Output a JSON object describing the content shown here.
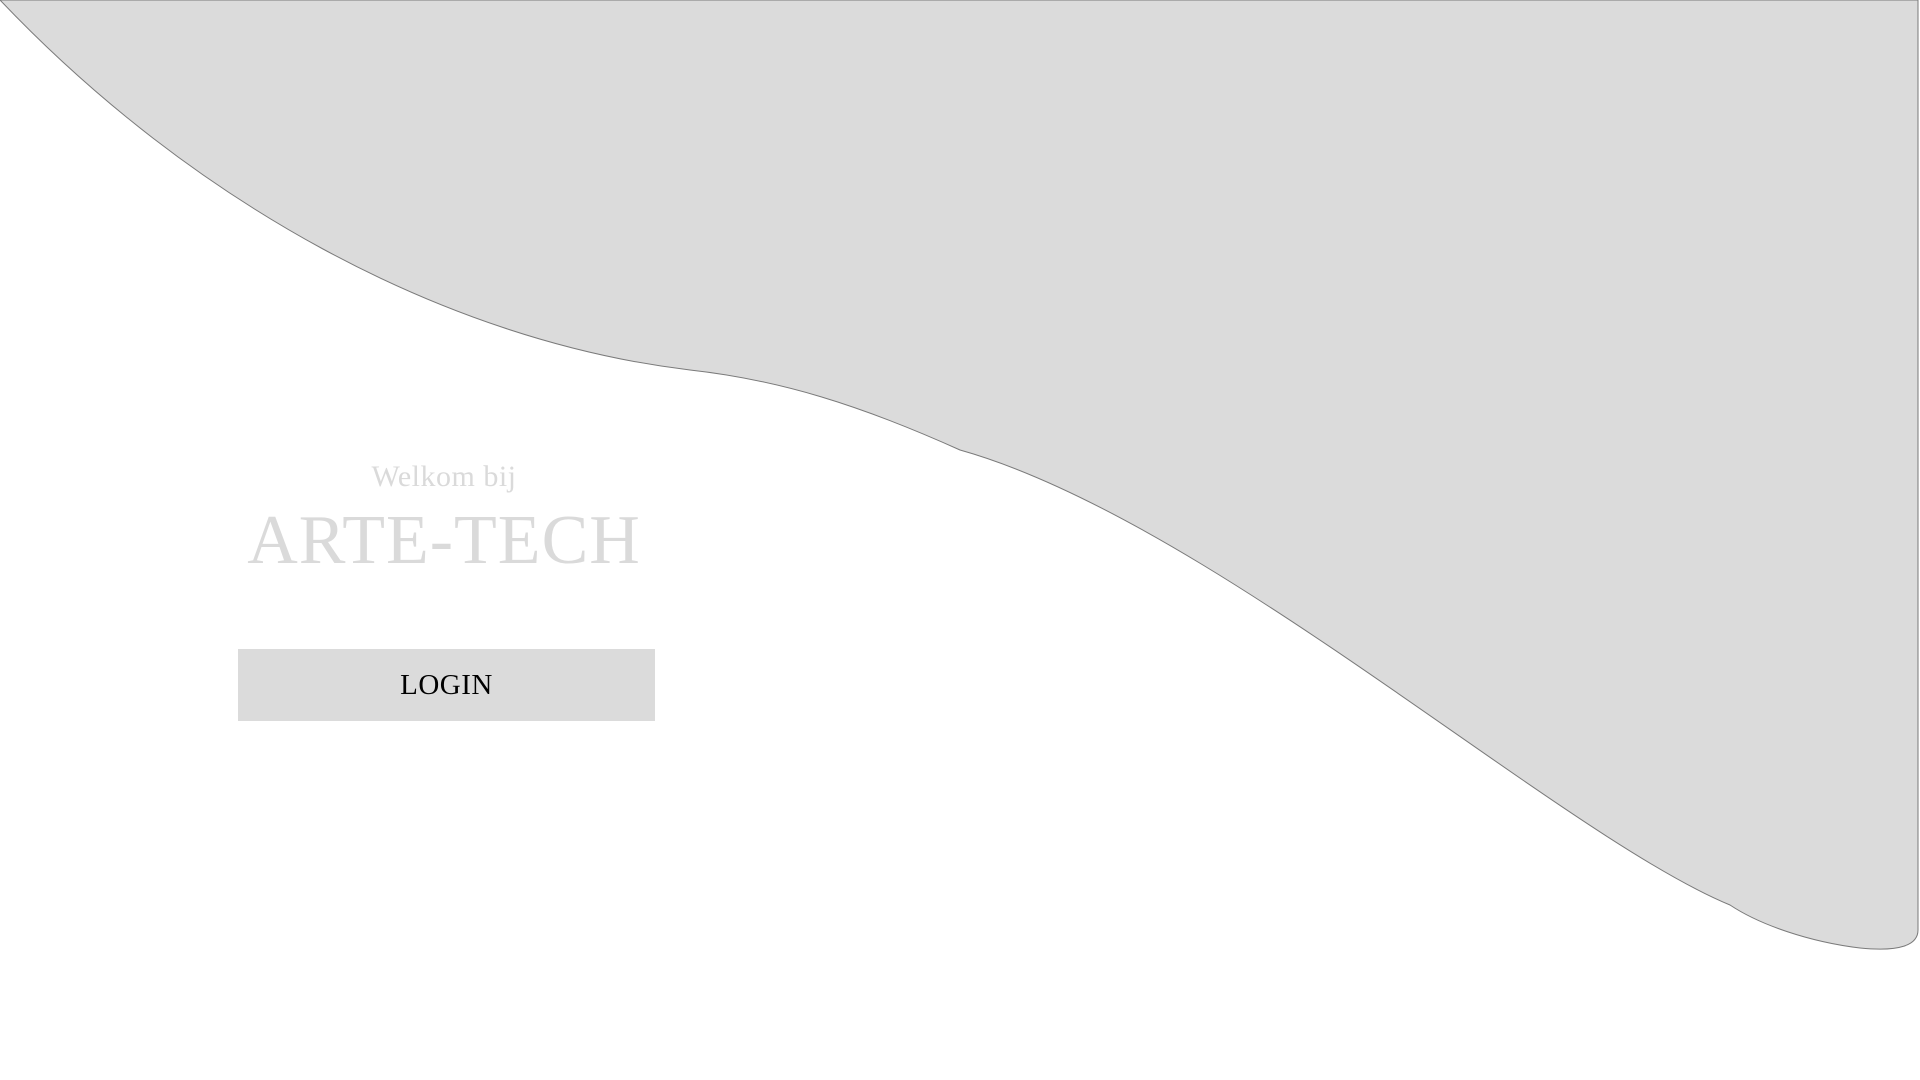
{
  "welcome": {
    "subtitle": "Welkom bij",
    "brand": "ARTE-TECH"
  },
  "actions": {
    "login_label": "LOGIN"
  },
  "colors": {
    "background": "#ffffff",
    "wave_fill": "#dbdbdb",
    "wave_stroke": "#7a7a7a",
    "welcome_text": "#dadada",
    "button_fill": "#dbdbdb",
    "button_text": "#000000"
  }
}
